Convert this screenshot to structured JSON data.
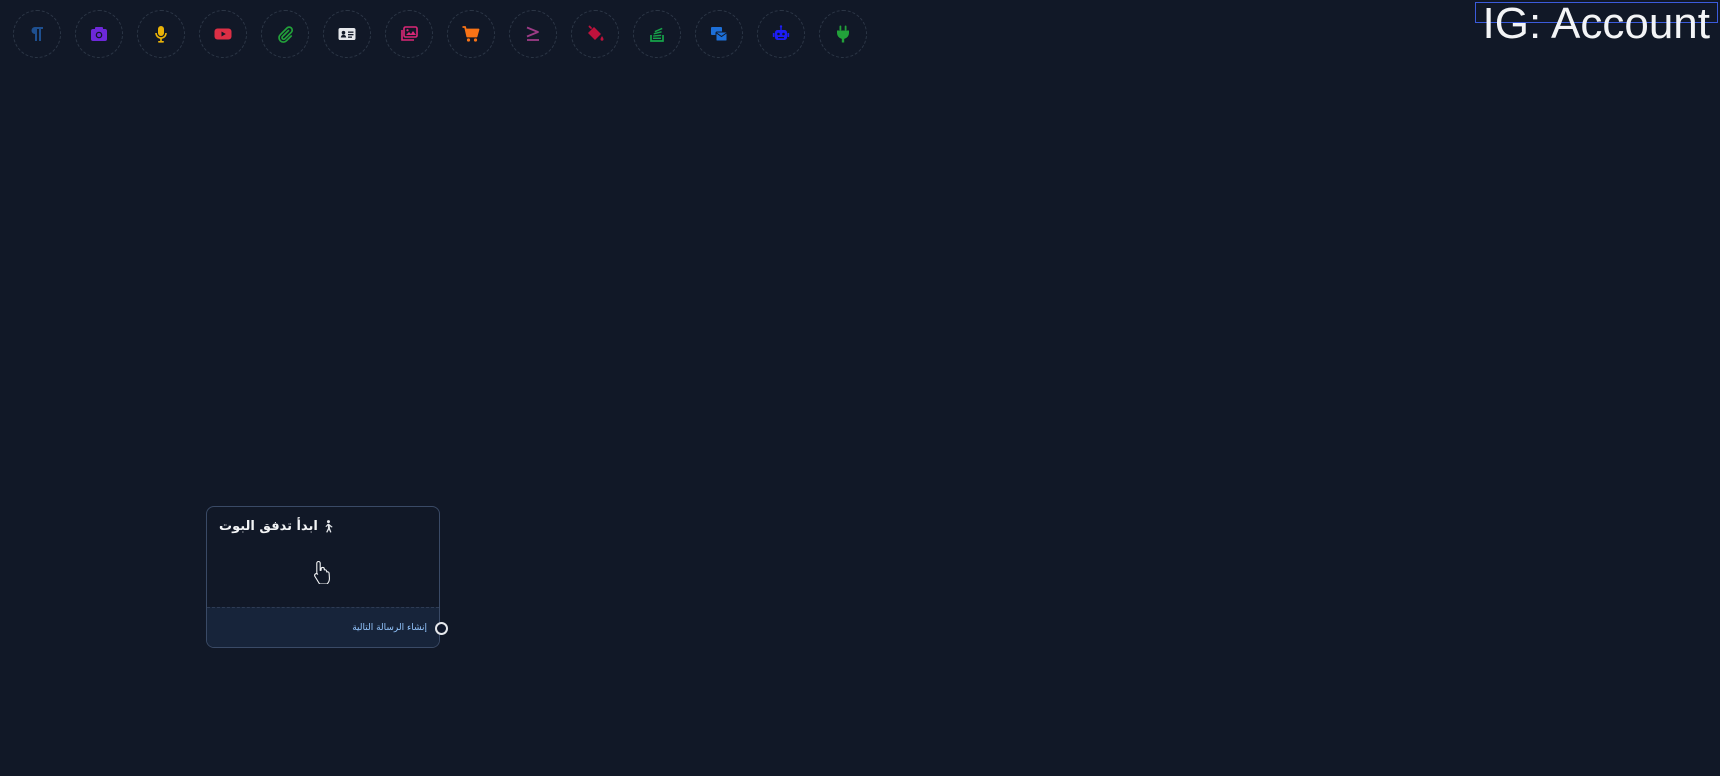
{
  "title": "IG: Account",
  "toolbar": {
    "tools": [
      {
        "icon": "paragraph-icon",
        "color": "#1e4f8f"
      },
      {
        "icon": "camera-icon",
        "color": "#6d28d9"
      },
      {
        "icon": "microphone-icon",
        "color": "#eab308"
      },
      {
        "icon": "youtube-icon",
        "color": "#dc2f45"
      },
      {
        "icon": "paperclip-icon",
        "color": "#22a13a"
      },
      {
        "icon": "contact-card-icon",
        "color": "#e5e7eb"
      },
      {
        "icon": "images-icon",
        "color": "#db2777"
      },
      {
        "icon": "cart-icon",
        "color": "#f97316"
      },
      {
        "icon": "greater-equal-icon",
        "color": "#9d3b86"
      },
      {
        "icon": "paint-bucket-icon",
        "color": "#be123c"
      },
      {
        "icon": "stack-icon",
        "color": "#16a34a"
      },
      {
        "icon": "mail-bulk-icon",
        "color": "#1d6fd8"
      },
      {
        "icon": "robot-icon",
        "color": "#1d1df5"
      },
      {
        "icon": "plug-icon",
        "color": "#22a13a"
      }
    ]
  },
  "node": {
    "title": "ابدأ تدفق البوت",
    "footer_label": "إنشاء الرسالة التالية"
  }
}
